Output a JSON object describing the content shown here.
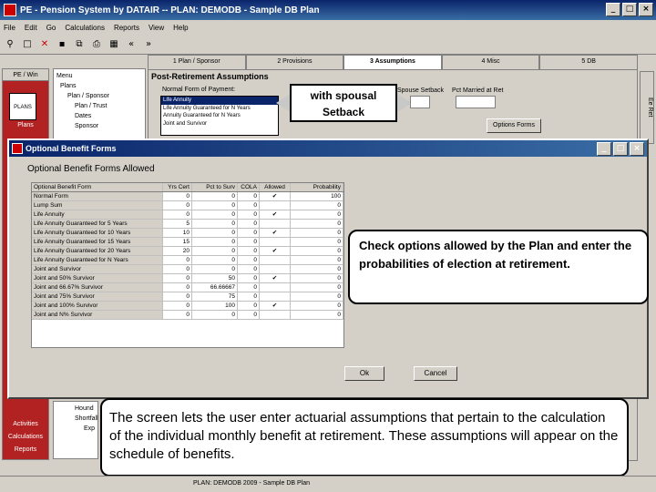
{
  "app": {
    "title": "PE - Pension System by DATAIR -- PLAN: DEMODB - Sample DB Plan"
  },
  "menu": [
    "File",
    "Edit",
    "Go",
    "Calculations",
    "Reports",
    "View",
    "Help"
  ],
  "toolbar": {
    "nav_back": "«",
    "nav_fwd": "»"
  },
  "sidebar": {
    "tab": "PE / Win",
    "plans_label": "Plans",
    "bottom": [
      "Activities",
      "Calculations",
      "Reports"
    ]
  },
  "tree": {
    "header": "Menu",
    "items": [
      "Plans",
      "Plan / Sponsor",
      "Plan / Trust",
      "Dates",
      "Sponsor"
    ]
  },
  "tree_bottom": {
    "items": [
      "Hound",
      "Shortfall",
      "Exp"
    ]
  },
  "tabs": [
    "1 Plan / Sponsor",
    "2 Provisions",
    "3 Assumptions",
    "4 Misc",
    "5 DB"
  ],
  "assumptions": {
    "title": "Post-Retirement Assumptions",
    "normal_form_label": "Normal Form of Payment:",
    "normal_form_options": [
      "Life Annuity",
      "Life Annuity Guaranteed for N Years",
      "Annuity Guaranteed for N Years",
      "Joint and Survivor"
    ],
    "spouse_setback_label": "Spouse Setback",
    "pct_married_label": "Pct Married at Ret",
    "options_button": "Options Forms",
    "ef_tab": "Ee Ret"
  },
  "callouts": {
    "spousal": "with spousal Setback",
    "options": "Check options allowed by the Plan and enter the probabilities of election at retirement.",
    "screen": "The screen lets the user enter actuarial assumptions that pertain to the calculation of the individual monthly benefit at retirement. These assumptions will appear on the schedule of benefits."
  },
  "dialog": {
    "title": "Optional Benefit Forms",
    "heading": "Optional Benefit Forms Allowed",
    "columns": [
      "Optional Benefit Form",
      "Yrs Cert",
      "Pct to Surv",
      "COLA",
      "Allowed",
      "Probability"
    ],
    "rows": [
      [
        "Normal Form",
        "0",
        "0",
        "0",
        "✔",
        "100"
      ],
      [
        "Lump Sum",
        "0",
        "0",
        "0",
        "",
        "0"
      ],
      [
        "Life Annuity",
        "0",
        "0",
        "0",
        "✔",
        "0"
      ],
      [
        "Life Annuity Guaranteed for 5 Years",
        "5",
        "0",
        "0",
        "",
        "0"
      ],
      [
        "Life Annuity Guaranteed for 10 Years",
        "10",
        "0",
        "0",
        "✔",
        "0"
      ],
      [
        "Life Annuity Guaranteed for 15 Years",
        "15",
        "0",
        "0",
        "",
        "0"
      ],
      [
        "Life Annuity Guaranteed for 20 Years",
        "20",
        "0",
        "0",
        "✔",
        "0"
      ],
      [
        "Life Annuity Guaranteed for N Years",
        "0",
        "0",
        "0",
        "",
        "0"
      ],
      [
        "Joint and Survivor",
        "0",
        "0",
        "0",
        "",
        "0"
      ],
      [
        "Joint and 50% Survivor",
        "0",
        "50",
        "0",
        "✔",
        "0"
      ],
      [
        "Joint and 66.67% Survivor",
        "0",
        "66.66667",
        "0",
        "",
        "0"
      ],
      [
        "Joint and 75% Survivor",
        "0",
        "75",
        "0",
        "",
        "0"
      ],
      [
        "Joint and 100% Survivor",
        "0",
        "100",
        "0",
        "✔",
        "0"
      ],
      [
        "Joint and N% Survivor",
        "0",
        "0",
        "0",
        "",
        "0"
      ]
    ],
    "ok": "Ok",
    "cancel": "Cancel"
  },
  "statusbar": {
    "left": "PLAN: DEMODB  2009 - Sample DB Plan"
  }
}
